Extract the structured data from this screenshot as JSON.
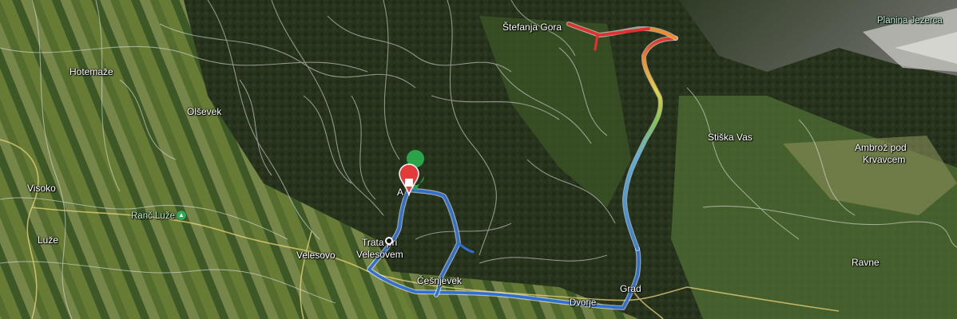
{
  "map": {
    "kind": "satellite",
    "places": [
      {
        "id": "stefanja-gora",
        "name": "Štefanja Gora"
      },
      {
        "id": "hotemaze",
        "name": "Hotemaže"
      },
      {
        "id": "olsevek",
        "name": "Olševek"
      },
      {
        "id": "visoko",
        "name": "Visoko"
      },
      {
        "id": "luze",
        "name": "Luže"
      },
      {
        "id": "velesovo",
        "name": "Velesovo"
      },
      {
        "id": "trata-1",
        "name": "Trata pri"
      },
      {
        "id": "trata-2",
        "name": "Velesovem"
      },
      {
        "id": "cesnjevek",
        "name": "Češnjevek"
      },
      {
        "id": "grad",
        "name": "Grad"
      },
      {
        "id": "stiska-vas",
        "name": "Stiška Vas"
      },
      {
        "id": "ambroz-1",
        "name": "Ambrož pod"
      },
      {
        "id": "ambroz-2",
        "name": "Krvavcem"
      },
      {
        "id": "ravne",
        "name": "Ravne"
      },
      {
        "id": "planina-jezerca",
        "name": "Planina Jezerca"
      },
      {
        "id": "ranc-luze",
        "name": "Ranč Luže"
      },
      {
        "id": "a-label",
        "name": "A"
      },
      {
        "id": "dvorje",
        "name": "Dvorje"
      }
    ],
    "poi": {
      "name": "Ranč Luže",
      "icon": "mountain-icon"
    },
    "route": {
      "colors": {
        "low": "#3a7fd6",
        "mid": "#7cc84a",
        "high": "#e03030",
        "peak": "#f08a2a"
      },
      "start_icon": "start-marker-icon",
      "end_icon": "end-marker-icon",
      "waypoint_icon": "waypoint-dot-icon"
    }
  }
}
